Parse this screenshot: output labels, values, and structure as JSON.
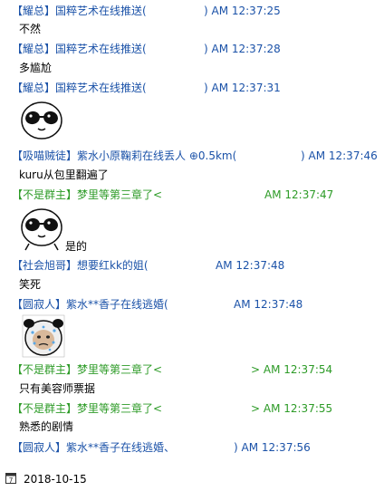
{
  "colors": {
    "blue": "#1b52a8",
    "green": "#2d9b27",
    "text": "#000000"
  },
  "messages": [
    {
      "head": "【耀总】国粹艺术在线推送(",
      "time": ") AM 12:37:25",
      "color": "blue",
      "body": "不然"
    },
    {
      "head": "【耀总】国粹艺术在线推送(",
      "time": ") AM 12:37:28",
      "color": "blue",
      "body": "多尴尬"
    },
    {
      "head": "【耀总】国粹艺术在线推送(",
      "time": ") AM 12:37:31",
      "color": "blue",
      "sticker": "panda-sunglasses"
    },
    {
      "head": "【吸喵贼徒】紫水小原鞠莉在线丢人 ⊕0.5km(",
      "time": ") AM 12:37:46",
      "color": "blue",
      "body": "kuru从包里翻遍了"
    },
    {
      "head": "【不是群主】梦里等第三章了<",
      "time": "AM 12:37:47",
      "color": "green",
      "sticker": "panda-sunglasses",
      "body": "是的"
    },
    {
      "head": "【社会旭哥】想要红kk的姐(",
      "time": "AM 12:37:48",
      "color": "blue",
      "body": "笑死"
    },
    {
      "head": "【圆寂人】紫水**香子在线逃婚(",
      "time": "AM 12:37:48",
      "color": "blue",
      "sticker": "panda-sweat"
    },
    {
      "head": "【不是群主】梦里等第三章了<",
      "time": "> AM 12:37:54",
      "color": "green",
      "body": "只有美容师票据"
    },
    {
      "head": "【不是群主】梦里等第三章了<",
      "time": "> AM 12:37:55",
      "color": "green",
      "body": "熟悉的剧情"
    },
    {
      "head": "【圆寂人】紫水**香子在线逃婚、",
      "time": ") AM 12:37:56",
      "color": "blue",
      "body": ""
    }
  ],
  "footer": {
    "date": "2018-10-15",
    "icon": "calendar-icon",
    "icon_digit": "7"
  }
}
